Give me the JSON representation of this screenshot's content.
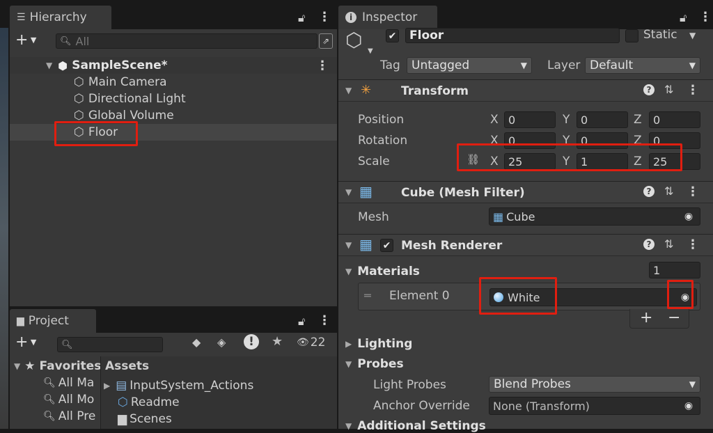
{
  "hierarchy": {
    "tab": "Hierarchy",
    "search_placeholder": "All",
    "scene": "SampleScene*",
    "items": [
      "Main Camera",
      "Directional Light",
      "Global Volume",
      "Floor"
    ]
  },
  "project": {
    "tab": "Project",
    "hidden_count": "22",
    "favorites_label": "Favorites",
    "favorites": [
      "All Ma",
      "All Mo",
      "All Pre"
    ],
    "assets_header": "Assets",
    "assets": [
      "InputSystem_Actions",
      "Readme",
      "Scenes"
    ]
  },
  "inspector": {
    "tab": "Inspector",
    "object_name": "Floor",
    "static_label": "Static",
    "tag_label": "Tag",
    "tag_value": "Untagged",
    "layer_label": "Layer",
    "layer_value": "Default",
    "transform": {
      "title": "Transform",
      "position_label": "Position",
      "rotation_label": "Rotation",
      "scale_label": "Scale",
      "position": {
        "x": "0",
        "y": "0",
        "z": "0"
      },
      "rotation": {
        "x": "0",
        "y": "0",
        "z": "0"
      },
      "scale": {
        "x": "25",
        "y": "1",
        "z": "25"
      },
      "x": "X",
      "y": "Y",
      "z": "Z"
    },
    "mesh_filter": {
      "title": "Cube (Mesh Filter)",
      "mesh_label": "Mesh",
      "mesh_value": "Cube"
    },
    "mesh_renderer": {
      "title": "Mesh Renderer",
      "materials_label": "Materials",
      "materials_count": "1",
      "element_label": "Element 0",
      "element_value": "White",
      "plus": "+",
      "minus": "−",
      "lighting_label": "Lighting",
      "probes_label": "Probes",
      "light_probes_label": "Light Probes",
      "light_probes_value": "Blend Probes",
      "anchor_label": "Anchor Override",
      "anchor_value": "None (Transform)",
      "additional_label": "Additional Settings"
    }
  },
  "colors": {
    "highlight": "#e01e10",
    "panel": "#383838"
  }
}
